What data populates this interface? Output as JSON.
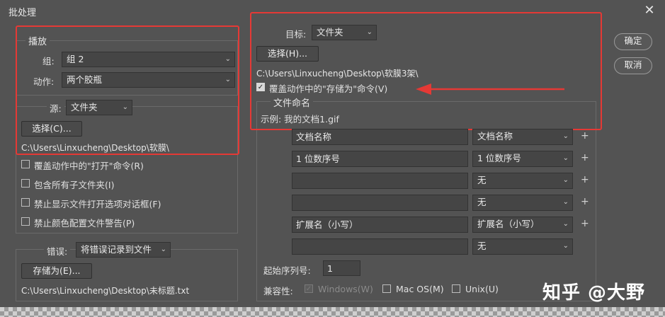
{
  "window": {
    "title": "批处理",
    "close_glyph": "✕"
  },
  "buttons": {
    "ok": "确定",
    "cancel": "取消"
  },
  "play": {
    "legend": "播放",
    "group_label": "组:",
    "group_value": "组 2",
    "action_label": "动作:",
    "action_value": "两个胶瓶"
  },
  "source": {
    "label": "源:",
    "value": "文件夹",
    "choose_button": "选择(C)...",
    "path": "C:\\Users\\Linxucheng\\Desktop\\软膜\\",
    "options": [
      {
        "label": "覆盖动作中的\"打开\"命令(R)",
        "checked": false
      },
      {
        "label": "包含所有子文件夹(I)",
        "checked": false
      },
      {
        "label": "禁止显示文件打开选项对话框(F)",
        "checked": false
      },
      {
        "label": "禁止颜色配置文件警告(P)",
        "checked": false
      }
    ]
  },
  "errors": {
    "label": "错误:",
    "value": "将错误记录到文件",
    "save_button": "存储为(E)...",
    "path": "C:\\Users\\Linxucheng\\Desktop\\未标题.txt"
  },
  "target": {
    "label": "目标:",
    "value": "文件夹",
    "choose_button": "选择(H)...",
    "path": "C:\\Users\\Linxucheng\\Desktop\\软膜3架\\",
    "override_label": "覆盖动作中的\"存储为\"命令(V)",
    "override_checked": true
  },
  "naming": {
    "legend": "文件命名",
    "example": "示例: 我的文档1.gif",
    "rows": [
      {
        "field": "文档名称",
        "select": "文档名称"
      },
      {
        "field": "1 位数序号",
        "select": "1 位数序号"
      },
      {
        "field": "",
        "select": "无"
      },
      {
        "field": "",
        "select": "无"
      },
      {
        "field": "扩展名（小写）",
        "select": "扩展名（小写）"
      },
      {
        "field": "",
        "select": "无"
      }
    ],
    "plus": "+",
    "start_serial_label": "起始序列号:",
    "start_serial_value": "1",
    "compat_label": "兼容性:",
    "compat": [
      {
        "label": "Windows(W)",
        "checked": true,
        "disabled": true
      },
      {
        "label": "Mac OS(M)",
        "checked": false,
        "disabled": false
      },
      {
        "label": "Unix(U)",
        "checked": false,
        "disabled": false
      }
    ]
  },
  "watermark": "知乎 @大野",
  "colors": {
    "annotation": "#e53935",
    "panel": "#535353"
  },
  "icons": {
    "chevron": "chevron-down-icon",
    "check": "checkmark-icon",
    "arrow": "red-arrow-annotation"
  }
}
